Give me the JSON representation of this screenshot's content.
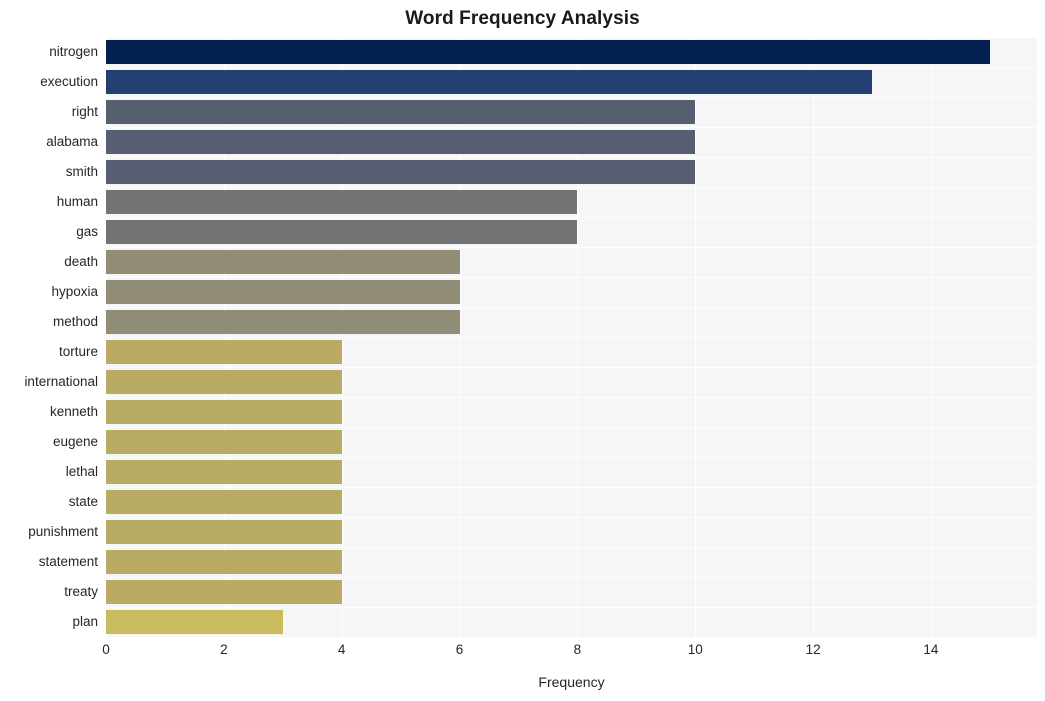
{
  "chart_data": {
    "type": "bar",
    "orientation": "horizontal",
    "title": "Word Frequency Analysis",
    "xlabel": "Frequency",
    "ylabel": "",
    "categories": [
      "nitrogen",
      "execution",
      "right",
      "alabama",
      "smith",
      "human",
      "gas",
      "death",
      "hypoxia",
      "method",
      "torture",
      "international",
      "kenneth",
      "eugene",
      "lethal",
      "state",
      "punishment",
      "statement",
      "treaty",
      "plan"
    ],
    "values": [
      15,
      13,
      10,
      10,
      10,
      8,
      8,
      6,
      6,
      6,
      4,
      4,
      4,
      4,
      4,
      4,
      4,
      4,
      4,
      3
    ],
    "bar_colors": [
      "#042050",
      "#243f72",
      "#585e72",
      "#585e72",
      "#585e72",
      "#737373",
      "#737373",
      "#918d76",
      "#918d76",
      "#918d76",
      "#b9aa65",
      "#b9aa65",
      "#b9aa65",
      "#b9aa65",
      "#b9aa65",
      "#b9aa65",
      "#b9aa65",
      "#b9aa65",
      "#b9aa65",
      "#c9bc5e"
    ],
    "xlim": [
      0,
      15.8
    ],
    "xticks": [
      0,
      2,
      4,
      6,
      8,
      10,
      12,
      14
    ],
    "xtick_labels": [
      "0",
      "2",
      "4",
      "6",
      "8",
      "10",
      "12",
      "14"
    ],
    "grid": true,
    "grid_color": "#ffffff",
    "plot_background": "#f6f6f6",
    "figure_background": "#ffffff",
    "legend": null
  }
}
